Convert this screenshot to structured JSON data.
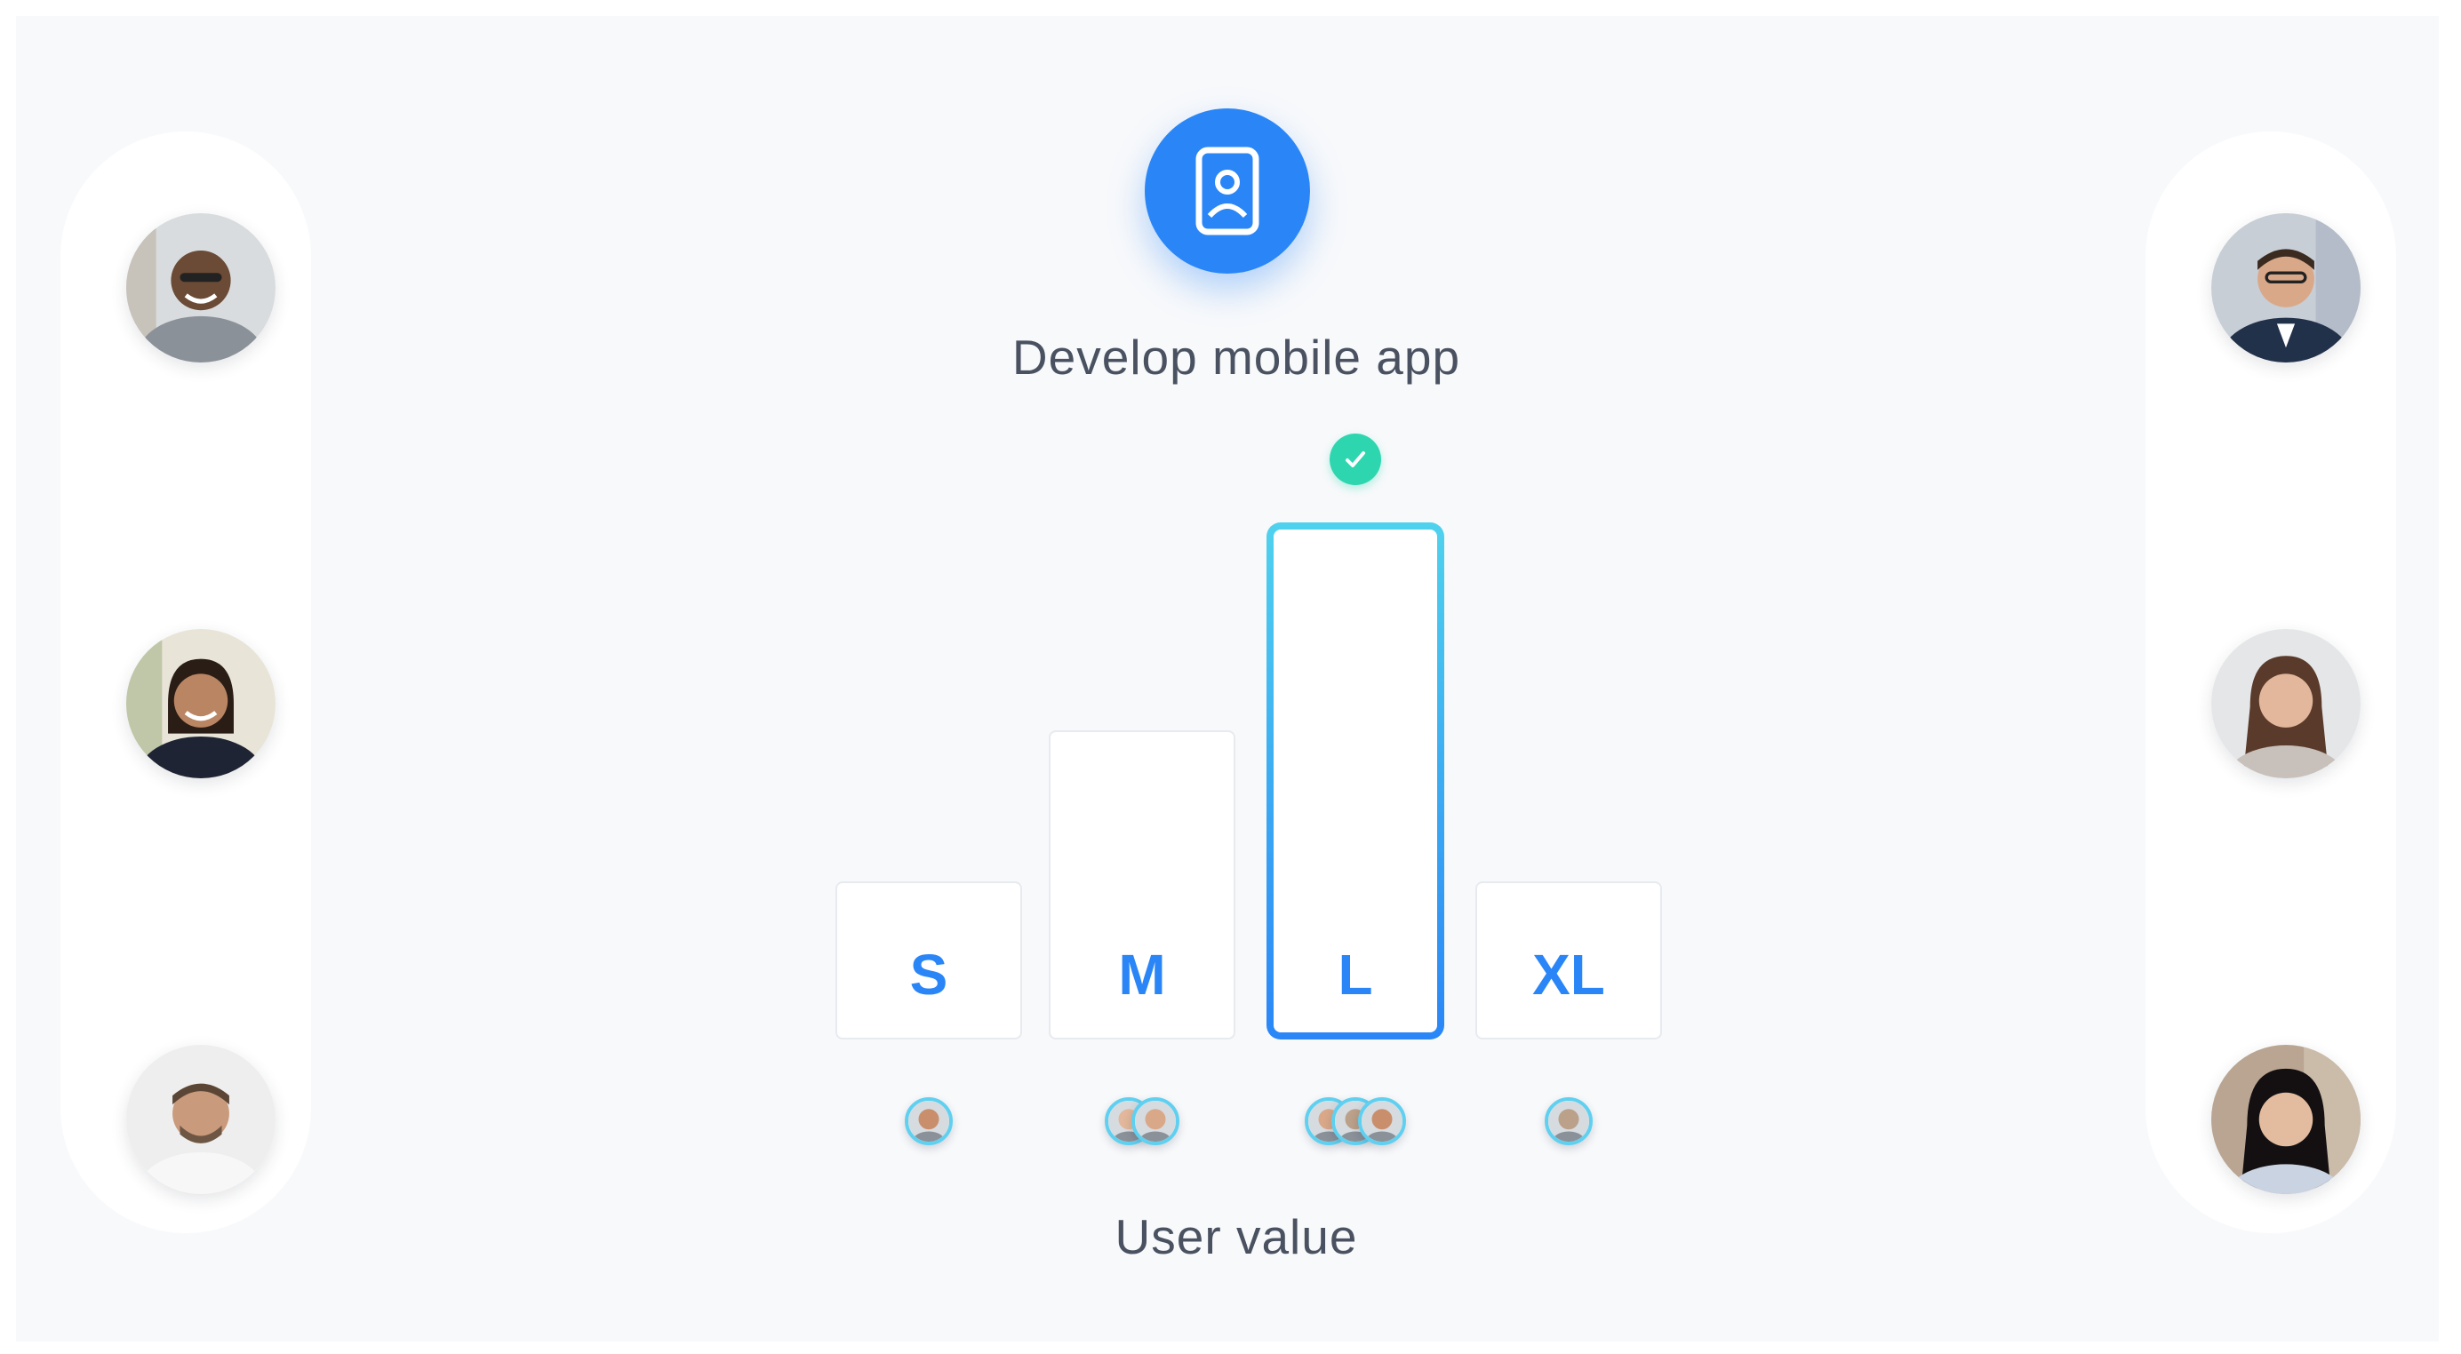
{
  "task": {
    "title": "Develop mobile app",
    "icon": "mobile-phone-user-icon",
    "accent_color": "#2a86f7"
  },
  "chart_data": {
    "type": "bar",
    "categories": [
      "S",
      "M",
      "L",
      "XL"
    ],
    "selected": "L",
    "xlabel": "User value",
    "votes": [
      1,
      2,
      3,
      1
    ],
    "selected_color": "#2ed6b0"
  },
  "participants": {
    "left": [
      "participant-avatar-1",
      "participant-avatar-2",
      "participant-avatar-3"
    ],
    "right": [
      "participant-avatar-4",
      "participant-avatar-5",
      "participant-avatar-6"
    ]
  }
}
